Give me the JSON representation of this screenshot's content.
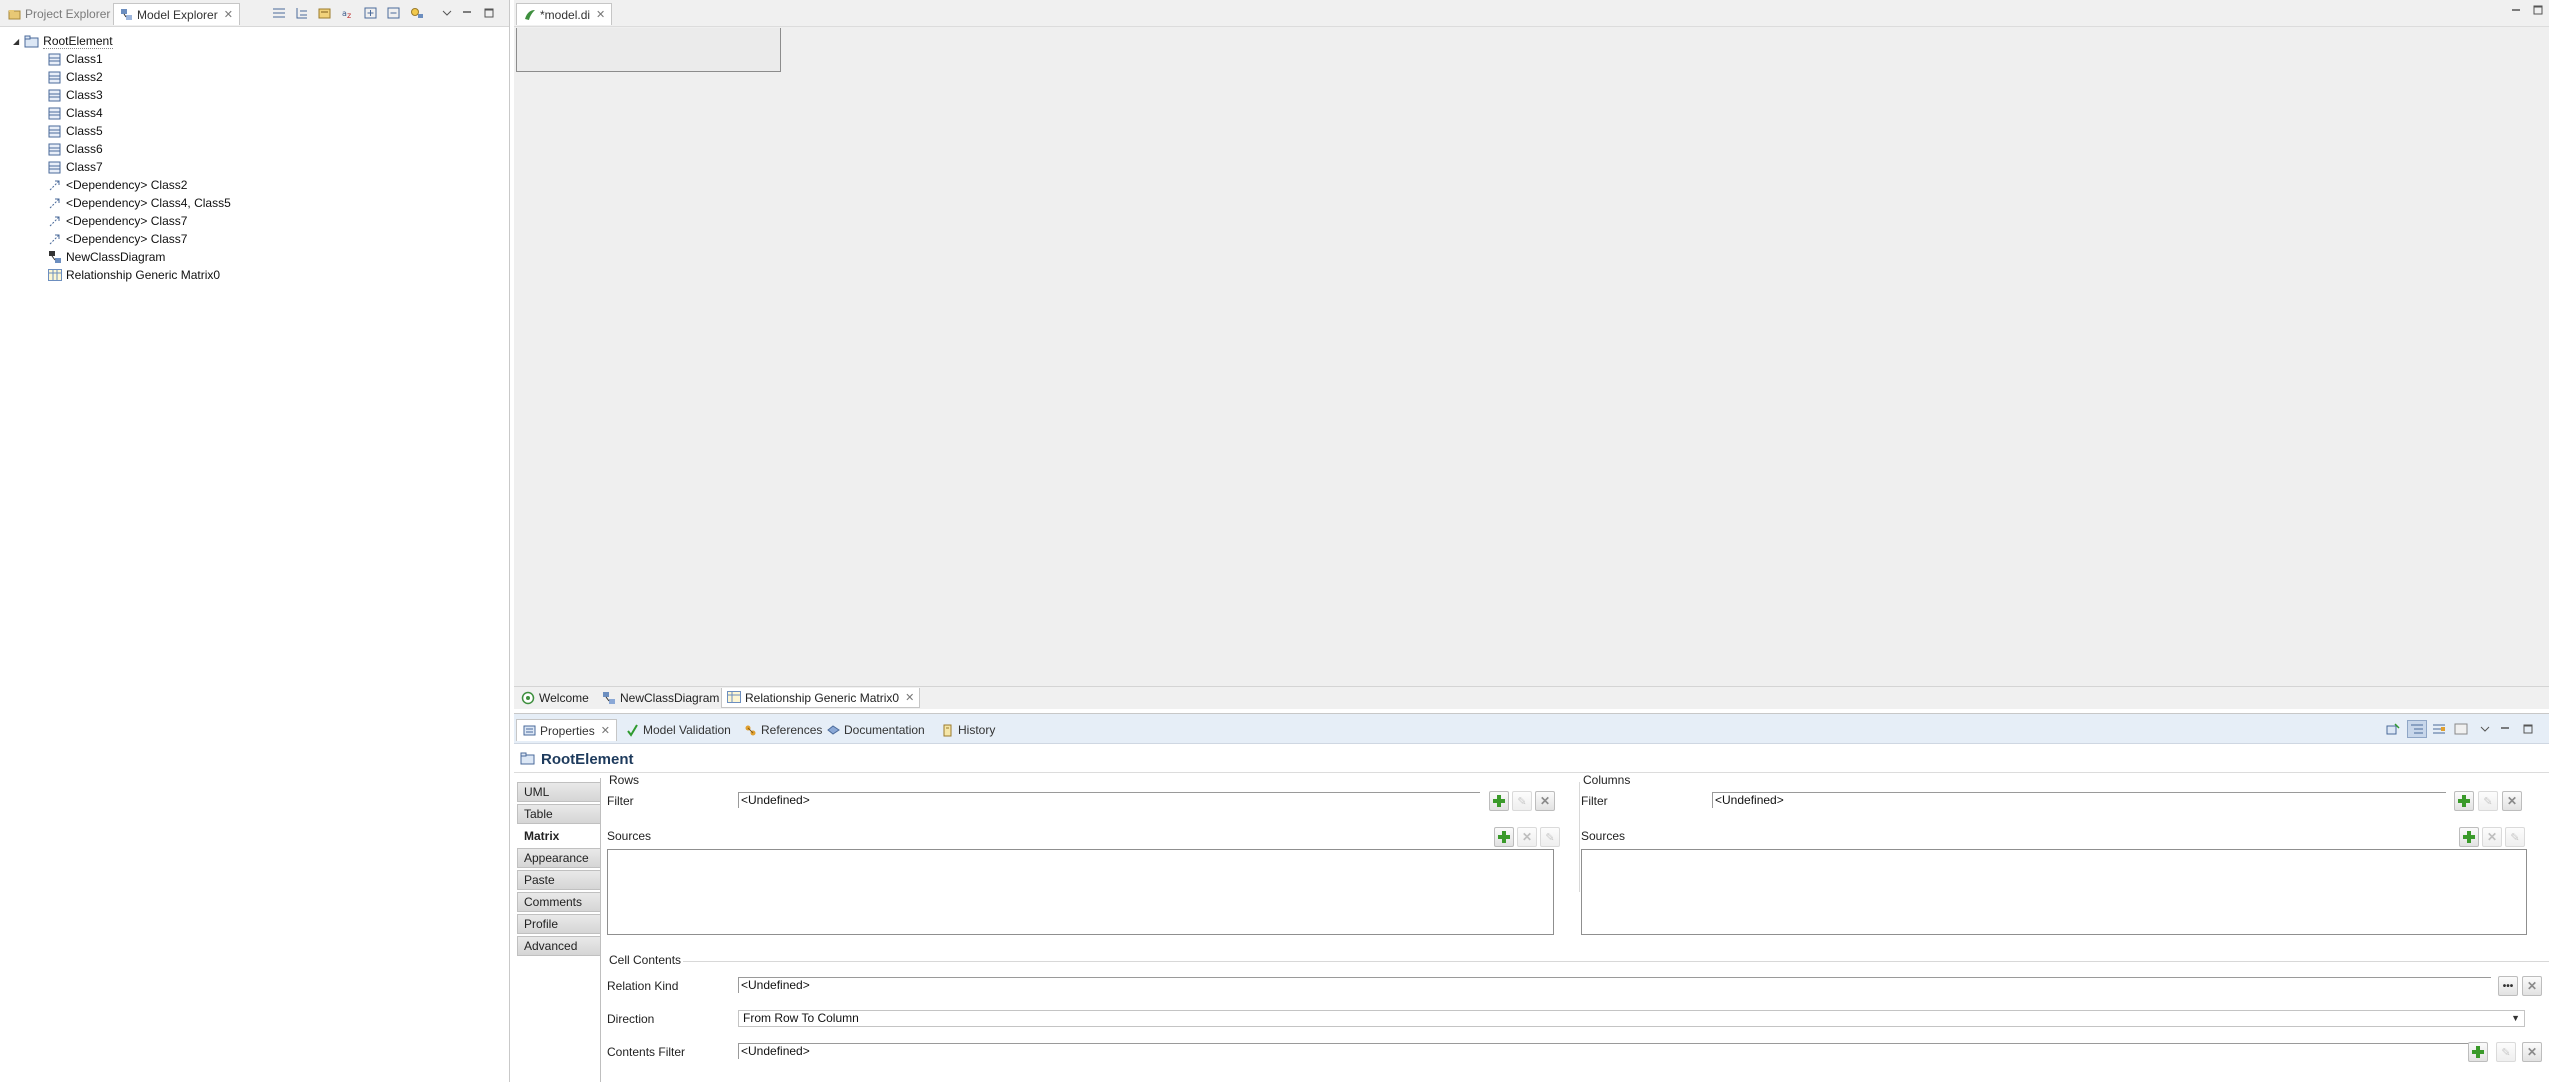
{
  "left_panel": {
    "tabs": [
      {
        "label": "Project Explorer",
        "icon": "project-explorer-icon"
      },
      {
        "label": "Model Explorer",
        "icon": "model-explorer-icon"
      }
    ],
    "tree": {
      "root": "RootElement",
      "items": [
        {
          "label": "Class1",
          "icon": "class-icon"
        },
        {
          "label": "Class2",
          "icon": "class-icon"
        },
        {
          "label": "Class3",
          "icon": "class-icon"
        },
        {
          "label": "Class4",
          "icon": "class-icon"
        },
        {
          "label": "Class5",
          "icon": "class-icon"
        },
        {
          "label": "Class6",
          "icon": "class-icon"
        },
        {
          "label": "Class7",
          "icon": "class-icon"
        },
        {
          "label": "<Dependency> Class2",
          "icon": "dependency-icon"
        },
        {
          "label": "<Dependency> Class4, Class5",
          "icon": "dependency-icon"
        },
        {
          "label": "<Dependency> Class7",
          "icon": "dependency-icon"
        },
        {
          "label": "<Dependency> Class7",
          "icon": "dependency-icon"
        },
        {
          "label": "NewClassDiagram",
          "icon": "class-diagram-icon"
        },
        {
          "label": "Relationship Generic Matrix0",
          "icon": "matrix-icon"
        }
      ]
    }
  },
  "editor": {
    "tab_label": "*model.di",
    "page_tabs": [
      {
        "label": "Welcome",
        "icon": "welcome-icon"
      },
      {
        "label": "NewClassDiagram",
        "icon": "class-diagram-icon"
      },
      {
        "label": "Relationship Generic Matrix0",
        "icon": "matrix-icon"
      }
    ]
  },
  "properties": {
    "tabs": [
      {
        "label": "Properties",
        "icon": "properties-icon"
      },
      {
        "label": "Model Validation",
        "icon": "validation-check-icon"
      },
      {
        "label": "References",
        "icon": "references-icon"
      },
      {
        "label": "Documentation",
        "icon": "documentation-icon"
      },
      {
        "label": "History",
        "icon": "history-icon"
      }
    ],
    "title": "RootElement",
    "side_tabs": [
      "UML",
      "Table",
      "Matrix",
      "Appearance",
      "Paste",
      "Comments",
      "Profile",
      "Advanced"
    ],
    "active_side_tab": "Matrix",
    "rows_group": {
      "label": "Rows",
      "filter_label": "Filter",
      "filter_value": "<Undefined>",
      "sources_label": "Sources"
    },
    "columns_group": {
      "label": "Columns",
      "filter_label": "Filter",
      "filter_value": "<Undefined>",
      "sources_label": "Sources"
    },
    "cell_contents": {
      "label": "Cell Contents",
      "relation_kind_label": "Relation Kind",
      "relation_kind_value": "<Undefined>",
      "direction_label": "Direction",
      "direction_value": "From Row To Column",
      "contents_filter_label": "Contents Filter",
      "contents_filter_value": "<Undefined>"
    }
  },
  "colors": {
    "accent_title": "#1d3a5c",
    "add_green": "#3a9a2a",
    "props_tabbar": "#e6eef7",
    "editor_bg": "#efefef"
  }
}
